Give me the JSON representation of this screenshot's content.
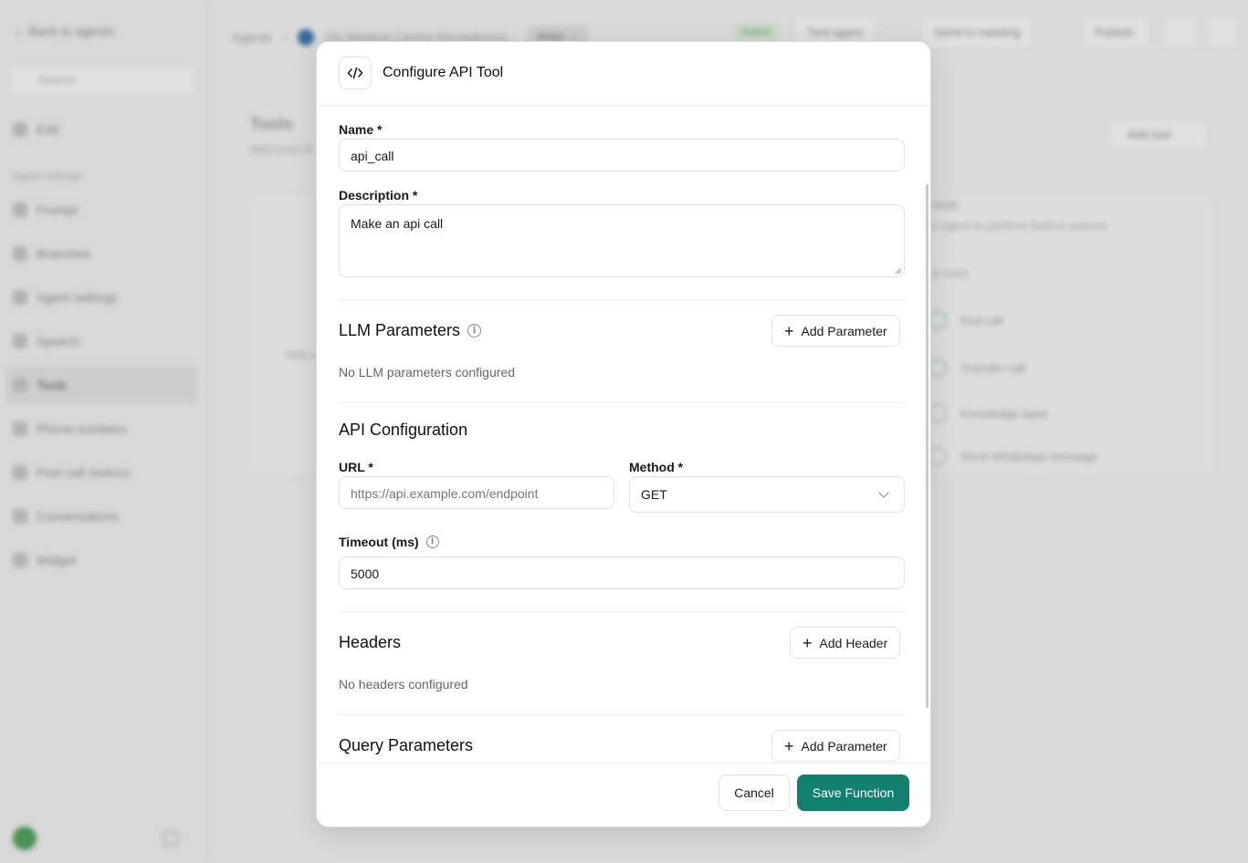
{
  "background": {
    "sidebar": {
      "back_label": "Back to agents",
      "search_placeholder": "Search",
      "top_item": "Edit",
      "section_label": "Agent settings",
      "items": [
        "Prompt",
        "Branches",
        "Agent settings",
        "Speech",
        "Tools",
        "Phone numbers",
        "Post call metrics",
        "Conversations",
        "Widget"
      ]
    },
    "topbar": {
      "crumb_root": "Agents",
      "agent_name": "(N) Medical Centre Receptionist...",
      "branch": "Main",
      "status": "Active",
      "test_label": "Test agent",
      "meeting_label": "Send to meeting",
      "publish_label": "Publish"
    },
    "content": {
      "title": "Tools",
      "subtitle": "Add tools th",
      "add_tool": "Add tool",
      "left_panel_text": "Add a",
      "right_title": "tools",
      "right_sub": "e agent to perform built-in actions",
      "right_head": "in tools",
      "tools": [
        "End call",
        "Transfer call",
        "Knowledge base",
        "Send WhatsApp message"
      ]
    }
  },
  "modal": {
    "title": "Configure API Tool",
    "name_label": "Name *",
    "name_value": "api_call",
    "description_label": "Description *",
    "description_value": "Make an api call",
    "llm_title": "LLM Parameters",
    "llm_add": "Add Parameter",
    "llm_empty": "No LLM parameters configured",
    "api_title": "API Configuration",
    "url_label": "URL *",
    "url_placeholder": "https://api.example.com/endpoint",
    "method_label": "Method *",
    "method_value": "GET",
    "timeout_label": "Timeout (ms)",
    "timeout_value": "5000",
    "headers_title": "Headers",
    "headers_add": "Add Header",
    "headers_empty": "No headers configured",
    "query_title": "Query Parameters",
    "query_add": "Add Parameter",
    "cancel_label": "Cancel",
    "save_label": "Save Function",
    "accent_color": "#127f6f"
  }
}
